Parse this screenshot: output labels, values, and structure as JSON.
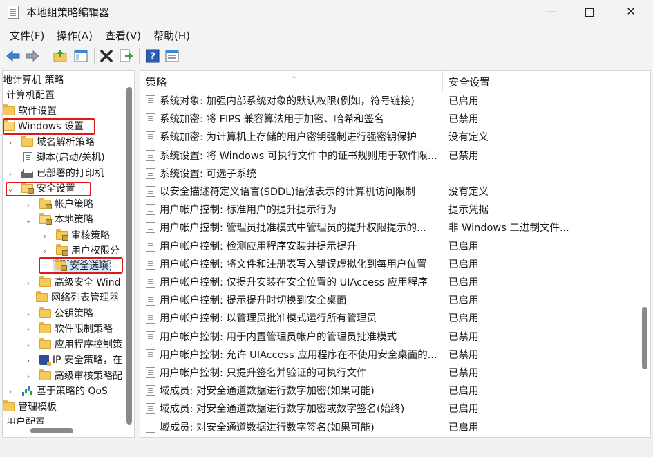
{
  "window": {
    "title": "本地组策略编辑器"
  },
  "menu": [
    "文件(F)",
    "操作(A)",
    "查看(V)",
    "帮助(H)"
  ],
  "toolbar_icons": [
    "back-arrow-icon",
    "forward-arrow-icon",
    "up-folder-icon",
    "show-hide-tree-icon",
    "delete-icon",
    "export-list-icon",
    "help-icon",
    "properties-icon"
  ],
  "tree": [
    {
      "label": "地计算机 策略"
    },
    {
      "label": "计算机配置"
    },
    {
      "label": "软件设置"
    },
    {
      "label": "Windows 设置"
    },
    {
      "label": "域名解析策略"
    },
    {
      "label": "脚本(启动/关机)"
    },
    {
      "label": "已部署的打印机"
    },
    {
      "label": "安全设置"
    },
    {
      "label": "帐户策略"
    },
    {
      "label": "本地策略"
    },
    {
      "label": "审核策略"
    },
    {
      "label": "用户权限分"
    },
    {
      "label": "安全选项"
    },
    {
      "label": "高级安全 Wind"
    },
    {
      "label": "网络列表管理器"
    },
    {
      "label": "公钥策略"
    },
    {
      "label": "软件限制策略"
    },
    {
      "label": "应用程序控制策"
    },
    {
      "label": "IP 安全策略，在"
    },
    {
      "label": "高级审核策略配"
    },
    {
      "label": "基于策略的 QoS"
    },
    {
      "label": "管理模板"
    },
    {
      "label": "用户配置"
    }
  ],
  "columns": {
    "policy": "策略",
    "setting": "安全设置"
  },
  "rows": [
    {
      "policy": "系统对象: 加强内部系统对象的默认权限(例如，符号链接)",
      "setting": "已启用"
    },
    {
      "policy": "系统加密: 将 FIPS 兼容算法用于加密、哈希和签名",
      "setting": "已禁用"
    },
    {
      "policy": "系统加密: 为计算机上存储的用户密钥强制进行强密钥保护",
      "setting": "没有定义"
    },
    {
      "policy": "系统设置: 将 Windows 可执行文件中的证书规则用于软件限...",
      "setting": "已禁用"
    },
    {
      "policy": "系统设置: 可选子系统",
      "setting": ""
    },
    {
      "policy": "以安全描述符定义语言(SDDL)语法表示的计算机访问限制",
      "setting": "没有定义"
    },
    {
      "policy": "用户帐户控制: 标准用户的提升提示行为",
      "setting": "提示凭据"
    },
    {
      "policy": "用户帐户控制: 管理员批准模式中管理员的提升权限提示的...",
      "setting": "非 Windows 二进制文件..."
    },
    {
      "policy": "用户帐户控制: 检测应用程序安装并提示提升",
      "setting": "已启用"
    },
    {
      "policy": "用户帐户控制: 将文件和注册表写入错误虚拟化到每用户位置",
      "setting": "已启用"
    },
    {
      "policy": "用户帐户控制: 仅提升安装在安全位置的 UIAccess 应用程序",
      "setting": "已启用"
    },
    {
      "policy": "用户帐户控制: 提示提升时切换到安全桌面",
      "setting": "已启用"
    },
    {
      "policy": "用户帐户控制: 以管理员批准模式运行所有管理员",
      "setting": "已启用"
    },
    {
      "policy": "用户帐户控制: 用于内置管理员帐户的管理员批准模式",
      "setting": "已禁用"
    },
    {
      "policy": "用户帐户控制: 允许 UIAccess 应用程序在不使用安全桌面的...",
      "setting": "已禁用"
    },
    {
      "policy": "用户帐户控制: 只提升签名并验证的可执行文件",
      "setting": "已禁用"
    },
    {
      "policy": "域成员: 对安全通道数据进行数字加密(如果可能)",
      "setting": "已启用"
    },
    {
      "policy": "域成员: 对安全通道数据进行数字加密或数字签名(始终)",
      "setting": "已启用"
    },
    {
      "policy": "域成员: 对安全通道数据进行数字签名(如果可能)",
      "setting": "已启用"
    }
  ]
}
